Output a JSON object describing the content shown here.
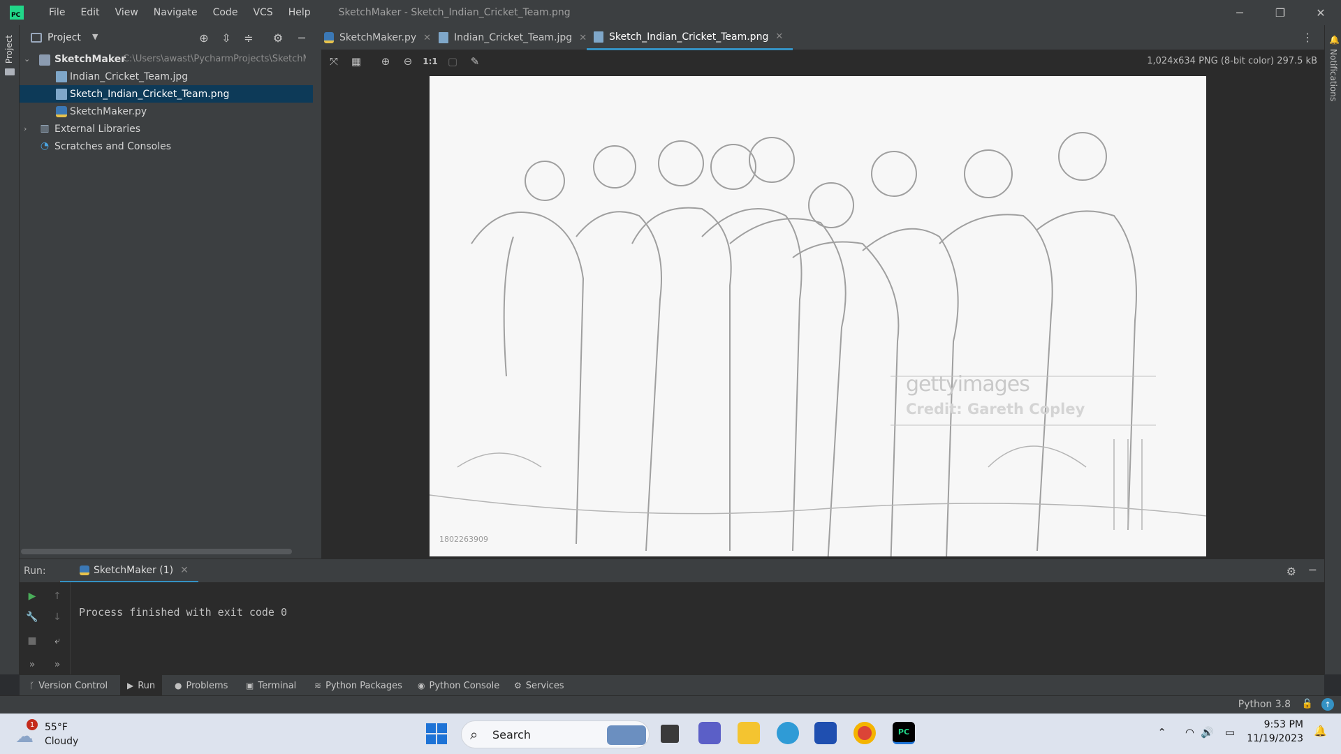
{
  "app": {
    "logo_text": "PC",
    "menu": [
      "File",
      "Edit",
      "View",
      "Navigate",
      "Code",
      "VCS",
      "Help"
    ],
    "window_title": "SketchMaker - Sketch_Indian_Cricket_Team.png",
    "left_stripe_label": "Project",
    "right_stripe_label": "Notifications"
  },
  "project_panel": {
    "title": "Project",
    "tree": [
      {
        "label": "SketchMaker",
        "path": "C:\\Users\\awast\\PycharmProjects\\SketchM",
        "type": "folder"
      },
      {
        "label": "Indian_Cricket_Team.jpg",
        "type": "image-file"
      },
      {
        "label": "Sketch_Indian_Cricket_Team.png",
        "type": "image-file",
        "selected": true
      },
      {
        "label": "SketchMaker.py",
        "type": "python-file"
      },
      {
        "label": "External Libraries",
        "type": "library"
      },
      {
        "label": "Scratches and Consoles",
        "type": "scratches"
      }
    ]
  },
  "tabs": [
    {
      "label": "SketchMaker.py",
      "icon": "python-file-icon"
    },
    {
      "label": "Indian_Cricket_Team.jpg",
      "icon": "image-file-icon"
    },
    {
      "label": "Sketch_Indian_Cricket_Team.png",
      "icon": "image-file-icon",
      "active": true
    }
  ],
  "image_toolbar": {
    "actual_size_label": "1:1",
    "image_info": "1,024x634 PNG (8-bit color) 297.5 kB"
  },
  "image": {
    "watermark_brand": "gettyimages",
    "watermark_credit": "Credit: Gareth Copley",
    "watermark_id": "1802263909"
  },
  "run": {
    "label": "Run:",
    "tab_label": "SketchMaker (1)",
    "output": "Process finished with exit code 0"
  },
  "bottom_tools": [
    "Version Control",
    "Run",
    "Problems",
    "Terminal",
    "Python Packages",
    "Python Console",
    "Services"
  ],
  "status": {
    "interpreter": "Python 3.8"
  },
  "taskbar": {
    "weather_temp": "55°F",
    "weather_desc": "Cloudy",
    "weather_badge": "1",
    "search_placeholder": "Search",
    "time": "9:53 PM",
    "date": "11/19/2023"
  }
}
